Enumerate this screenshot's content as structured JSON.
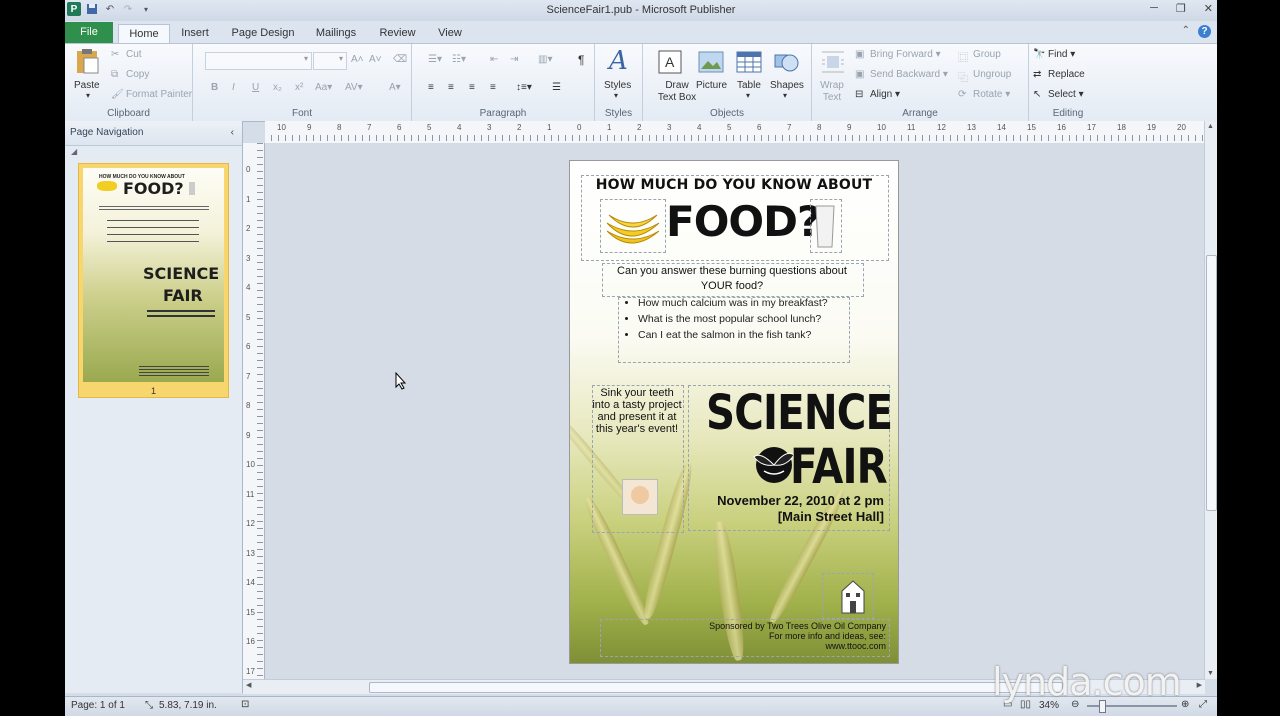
{
  "window": {
    "title": "ScienceFair1.pub  -  Microsoft Publisher"
  },
  "tabs": [
    "File",
    "Home",
    "Insert",
    "Page Design",
    "Mailings",
    "Review",
    "View"
  ],
  "ribbon": {
    "clipboard": {
      "label": "Clipboard",
      "paste": "Paste",
      "cut": "Cut",
      "copy": "Copy",
      "format_painter": "Format Painter"
    },
    "font": {
      "label": "Font"
    },
    "paragraph": {
      "label": "Paragraph"
    },
    "styles": {
      "label": "Styles",
      "styles_btn": "Styles"
    },
    "objects": {
      "label": "Objects",
      "draw_text_box": "Draw Text Box",
      "picture": "Picture",
      "table": "Table",
      "shapes": "Shapes"
    },
    "arrange": {
      "label": "Arrange",
      "wrap_text": "Wrap Text",
      "bring_forward": "Bring Forward",
      "send_backward": "Send Backward",
      "align": "Align",
      "group": "Group",
      "ungroup": "Ungroup",
      "rotate": "Rotate"
    },
    "editing": {
      "label": "Editing",
      "find": "Find",
      "replace": "Replace",
      "select": "Select"
    }
  },
  "page_navigation": {
    "title": "Page Navigation",
    "page_number": "1"
  },
  "rulers": {
    "h": [
      "10",
      "9",
      "8",
      "7",
      "6",
      "5",
      "4",
      "3",
      "2",
      "1",
      "0",
      "1",
      "2",
      "3",
      "4",
      "5",
      "6",
      "7",
      "8",
      "9",
      "10",
      "11",
      "12",
      "13",
      "14",
      "15",
      "16",
      "17",
      "18",
      "19",
      "20"
    ],
    "v": [
      "0",
      "1",
      "2",
      "3",
      "4",
      "5",
      "6",
      "7",
      "8",
      "9",
      "10",
      "11",
      "12",
      "13",
      "14",
      "15",
      "16",
      "17"
    ]
  },
  "publication": {
    "header": "HOW MUCH DO YOU KNOW ABOUT",
    "headline": "FOOD?",
    "question": "Can you answer these burning questions about YOUR food?",
    "bullets": [
      "How much calcium was in my breakfast?",
      "What is the most popular school lunch?",
      "Can I eat the salmon in the fish tank?"
    ],
    "sidebar": "Sink your teeth into a tasty project and present it at this year's event!",
    "science": "SCIENCE",
    "fair": "FAIR",
    "date": "November 22, 2010 at 2 pm",
    "location": "[Main Street Hall]",
    "sponsor_lines": [
      "Sponsored by Two Trees Olive Oil Company",
      "For more info and ideas, see:",
      "www.ttooc.com"
    ]
  },
  "status": {
    "page": "Page: 1 of 1",
    "position": "5.83, 7.19 in.",
    "zoom": "34%"
  },
  "watermark": "lynda.com"
}
